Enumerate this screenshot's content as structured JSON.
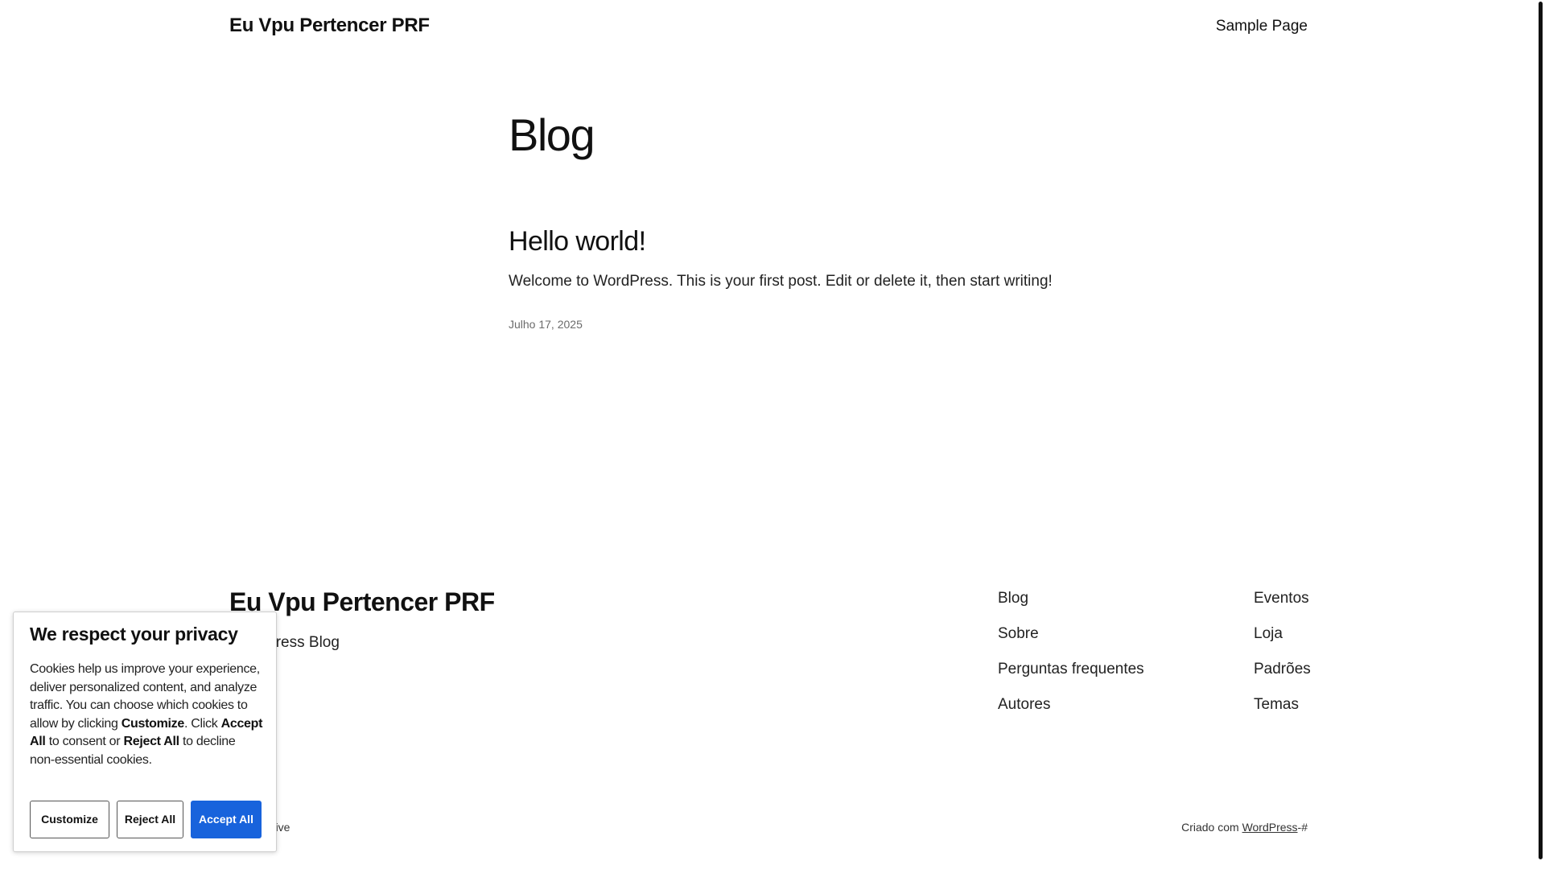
{
  "header": {
    "site_title": "Eu Vpu Pertencer PRF",
    "nav_item": "Sample Page"
  },
  "main": {
    "page_title": "Blog",
    "post": {
      "title": "Hello world!",
      "excerpt": "Welcome to WordPress. This is your first post. Edit or delete it, then start writing!",
      "date": "Julho 17, 2025"
    }
  },
  "footer": {
    "site_title": "Eu Vpu Pertencer PRF",
    "tagline": "WordPress Blog",
    "nav_col1": [
      "Blog",
      "Sobre",
      "Perguntas frequentes",
      "Autores"
    ],
    "nav_col2": [
      "Eventos",
      "Loja",
      "Padrões",
      "Temas"
    ],
    "credit_left": "Twenty-Five",
    "credit_right_prefix": "Criado com",
    "credit_right_link": "WordPress",
    "credit_right_suffix": "-#"
  },
  "cookie_banner": {
    "title": "We respect your privacy",
    "text_1": "Cookies help us improve your experience, deliver personalized content, and analyze traffic. You can choose which cookies to allow by clicking",
    "bold_customize": "Customize",
    "text_2": ". Click",
    "bold_accept": "Accept All",
    "text_3": "to consent or",
    "bold_reject": "Reject All",
    "text_4": "to decline non-essential cookies.",
    "customize_label": "Customize",
    "reject_label": "Reject All",
    "accept_label": "Accept All"
  },
  "colors": {
    "accent_button": "#1863dc",
    "text": "#111111",
    "background": "#ffffff"
  }
}
